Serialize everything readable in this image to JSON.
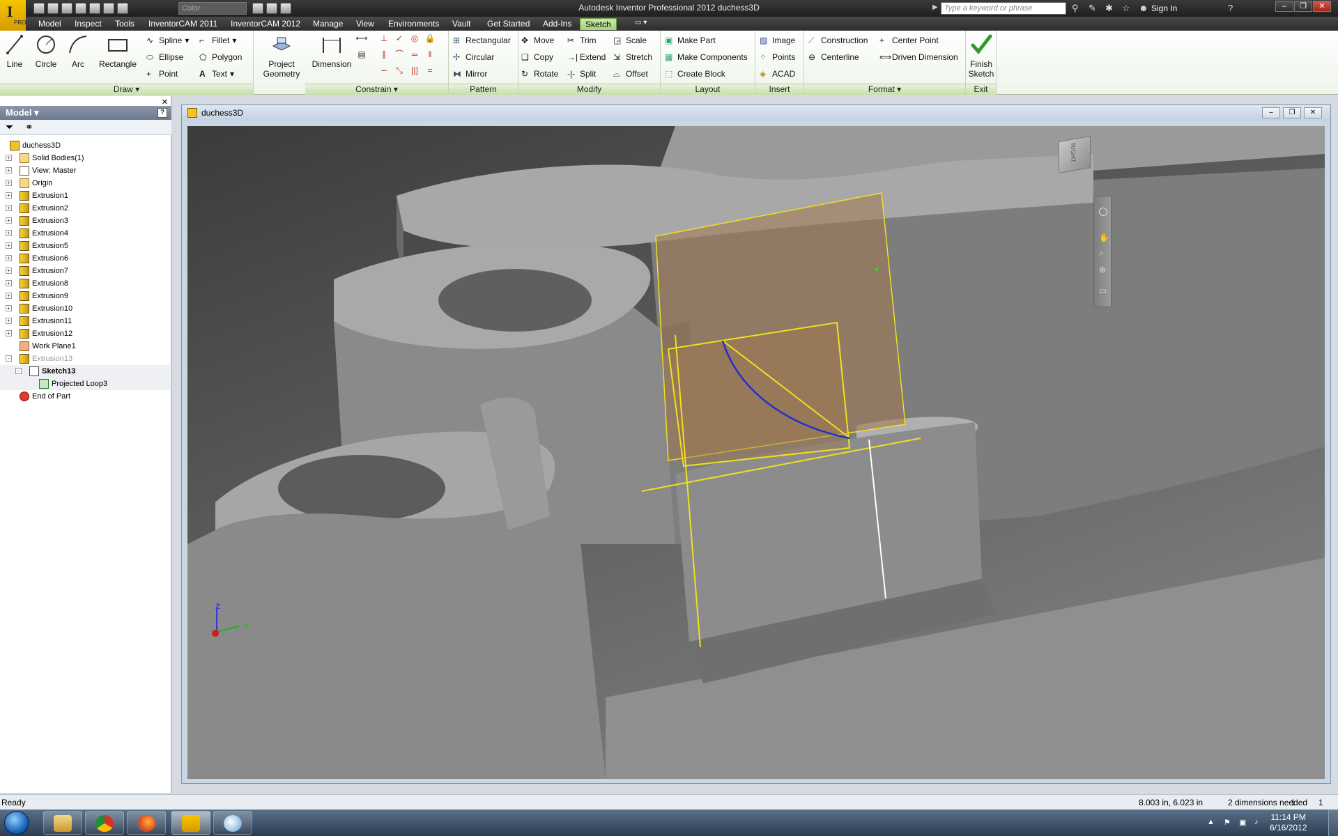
{
  "titlebar": {
    "title": "Autodesk Inventor Professional 2012    duchess3D",
    "app_badge": "PRO",
    "color_combo": "Color",
    "search_placeholder": "Type a keyword or phrase",
    "sign_in": "Sign In"
  },
  "menu": {
    "tabs": [
      "Model",
      "Inspect",
      "Tools",
      "InventorCAM 2011",
      "InventorCAM 2012",
      "Manage",
      "View",
      "Environments",
      "Vault",
      "Get Started",
      "Add-Ins",
      "Sketch"
    ],
    "active_tab": "Sketch"
  },
  "ribbon": {
    "draw": {
      "title": "Draw",
      "line": "Line",
      "circle": "Circle",
      "arc": "Arc",
      "rectangle": "Rectangle",
      "spline": "Spline",
      "ellipse": "Ellipse",
      "point": "Point",
      "fillet": "Fillet",
      "polygon": "Polygon",
      "text": "Text",
      "project_geometry_1": "Project",
      "project_geometry_2": "Geometry"
    },
    "constrain": {
      "title": "Constrain",
      "dimension": "Dimension"
    },
    "pattern": {
      "title": "Pattern",
      "rectangular": "Rectangular",
      "circular": "Circular",
      "mirror": "Mirror"
    },
    "modify": {
      "title": "Modify",
      "move": "Move",
      "copy": "Copy",
      "rotate": "Rotate",
      "trim": "Trim",
      "extend": "Extend",
      "split": "Split",
      "scale": "Scale",
      "stretch": "Stretch",
      "offset": "Offset"
    },
    "layout": {
      "title": "Layout",
      "make_part": "Make Part",
      "make_components": "Make Components",
      "create_block": "Create Block"
    },
    "insert": {
      "title": "Insert",
      "image": "Image",
      "points": "Points",
      "acad": "ACAD"
    },
    "format": {
      "title": "Format",
      "construction": "Construction",
      "centerline": "Centerline",
      "center_point": "Center Point",
      "driven_dimension": "Driven Dimension"
    },
    "exit": {
      "title": "Exit",
      "finish_1": "Finish",
      "finish_2": "Sketch"
    }
  },
  "browser": {
    "header": "Model",
    "help": "?",
    "tree": [
      {
        "label": "duchess3D",
        "icon": "part-icon",
        "level": 0,
        "expander": ""
      },
      {
        "label": "Solid Bodies(1)",
        "icon": "folder-icon",
        "level": 1,
        "expander": "+"
      },
      {
        "label": "View: Master",
        "icon": "view-icon",
        "level": 1,
        "expander": "+"
      },
      {
        "label": "Origin",
        "icon": "folder-icon",
        "level": 1,
        "expander": "+"
      },
      {
        "label": "Extrusion1",
        "icon": "extrusion-icon",
        "level": 1,
        "expander": "+"
      },
      {
        "label": "Extrusion2",
        "icon": "extrusion-icon",
        "level": 1,
        "expander": "+"
      },
      {
        "label": "Extrusion3",
        "icon": "extrusion-icon",
        "level": 1,
        "expander": "+"
      },
      {
        "label": "Extrusion4",
        "icon": "extrusion-icon",
        "level": 1,
        "expander": "+"
      },
      {
        "label": "Extrusion5",
        "icon": "extrusion-icon",
        "level": 1,
        "expander": "+"
      },
      {
        "label": "Extrusion6",
        "icon": "extrusion-icon",
        "level": 1,
        "expander": "+"
      },
      {
        "label": "Extrusion7",
        "icon": "extrusion-icon",
        "level": 1,
        "expander": "+"
      },
      {
        "label": "Extrusion8",
        "icon": "extrusion-icon",
        "level": 1,
        "expander": "+"
      },
      {
        "label": "Extrusion9",
        "icon": "extrusion-icon",
        "level": 1,
        "expander": "+"
      },
      {
        "label": "Extrusion10",
        "icon": "extrusion-icon",
        "level": 1,
        "expander": "+"
      },
      {
        "label": "Extrusion11",
        "icon": "extrusion-icon",
        "level": 1,
        "expander": "+"
      },
      {
        "label": "Extrusion12",
        "icon": "extrusion-icon",
        "level": 1,
        "expander": "+"
      },
      {
        "label": "Work Plane1",
        "icon": "workplane-icon",
        "level": 1,
        "expander": ""
      },
      {
        "label": "Extrusion13",
        "icon": "extrusion-icon",
        "level": 1,
        "expander": "-",
        "dim": true
      },
      {
        "label": "Sketch13",
        "icon": "sketch-icon",
        "level": 2,
        "expander": "-",
        "bold": true,
        "selected": true
      },
      {
        "label": "Projected Loop3",
        "icon": "projected-loop-icon",
        "level": 3,
        "expander": "",
        "selected": true
      },
      {
        "label": "End of Part",
        "icon": "end-of-part-icon",
        "level": 1,
        "expander": ""
      }
    ]
  },
  "document": {
    "title": "duchess3D",
    "viewcube_label": "RIGHT",
    "axis_z": "Z",
    "axis_y": "Y"
  },
  "status": {
    "left": "Ready",
    "coords": "8.003 in, 6.023 in",
    "dims_needed": "2 dimensions needed",
    "n1": "1",
    "n2": "1"
  },
  "taskbar": {
    "time": "11:14 PM",
    "date": "6/16/2012"
  },
  "colors": {
    "sketch_yellow": "#f0e020",
    "sketch_blue": "#2030c8",
    "plane_fill": "#a0784e",
    "ribbon_green": "#c6e0a9",
    "active_tab": "#a4d27a"
  }
}
